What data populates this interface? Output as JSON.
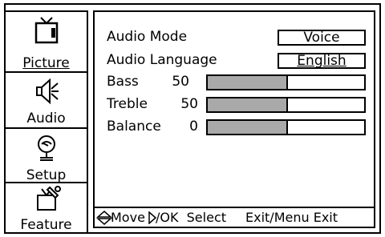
{
  "sidebar": {
    "tabs": [
      {
        "label": "Picture",
        "icon": "tv-icon",
        "active": true
      },
      {
        "label": "Audio",
        "icon": "speaker-icon",
        "active": false
      },
      {
        "label": "Setup",
        "icon": "satellite-dish-icon",
        "active": false
      },
      {
        "label": "Feature",
        "icon": "tools-icon",
        "active": false
      }
    ]
  },
  "audio": {
    "audio_mode": {
      "label": "Audio Mode",
      "value": "Voice"
    },
    "audio_language": {
      "label": "Audio Language",
      "value": "English"
    },
    "bass": {
      "label": "Bass",
      "value": "50",
      "level": 50
    },
    "treble": {
      "label": "Treble",
      "value": "50",
      "level": 50
    },
    "balance": {
      "label": "Balance",
      "value": "0",
      "level": 50
    }
  },
  "status": {
    "move": "Move",
    "ok_select": "/OK  Select",
    "exit": "Exit/Menu Exit"
  },
  "colors": {
    "bar_fill": "#a9a9a9",
    "border": "#000000",
    "background": "#ffffff"
  }
}
